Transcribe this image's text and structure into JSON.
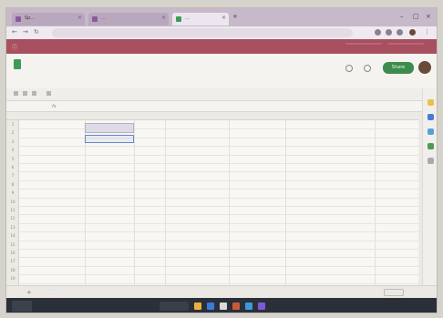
{
  "browser": {
    "tabs": [
      {
        "label": "Sp..."
      },
      {
        "label": "..."
      },
      {
        "label": "..."
      }
    ]
  },
  "sheets": {
    "share_label": "Share"
  },
  "grid": {
    "row_numbers": [
      "1",
      "2",
      "3",
      "4",
      "5",
      "6",
      "7",
      "8",
      "9",
      "10",
      "11",
      "12",
      "13",
      "14",
      "15",
      "16",
      "17",
      "18",
      "19"
    ]
  },
  "colors": {
    "banner": "#a8505f",
    "share_button": "#3d8c4e",
    "sheets_logo": "#3f9a5a",
    "taskbar": "#2b2f38"
  }
}
